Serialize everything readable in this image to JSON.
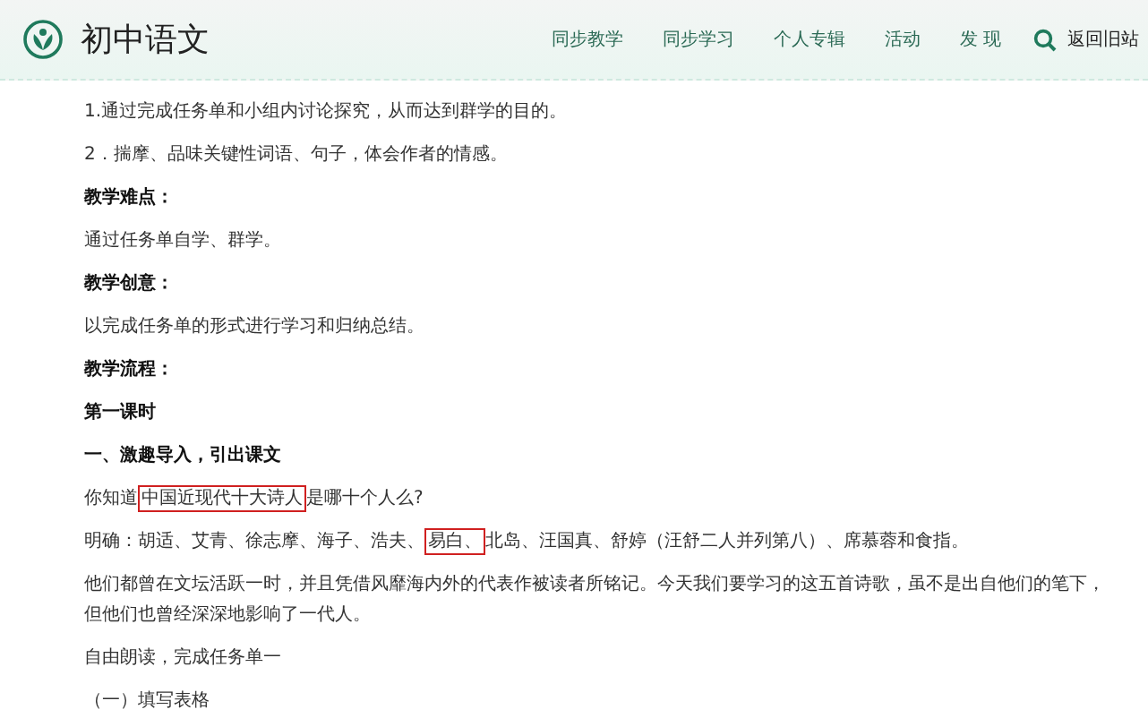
{
  "header": {
    "site_title": "初中语文",
    "nav": [
      {
        "label": "同步教学"
      },
      {
        "label": "同步学习"
      },
      {
        "label": "个人专辑"
      },
      {
        "label": "活动"
      },
      {
        "label": "发 现"
      }
    ],
    "back_link": "返回旧站"
  },
  "article": [
    {
      "kind": "text",
      "segments": [
        {
          "text": "1.通过完成任务单和小组内讨论探究，从而达到群学的目的。",
          "highlighted": false
        }
      ]
    },
    {
      "kind": "text",
      "segments": [
        {
          "text": "2．揣摩、品味关键性词语、句子，体会作者的情感。",
          "highlighted": false
        }
      ]
    },
    {
      "kind": "heading",
      "segments": [
        {
          "text": "教学难点：",
          "highlighted": false
        }
      ]
    },
    {
      "kind": "text",
      "segments": [
        {
          "text": "通过任务单自学、群学。",
          "highlighted": false
        }
      ]
    },
    {
      "kind": "heading",
      "segments": [
        {
          "text": "教学创意：",
          "highlighted": false
        }
      ]
    },
    {
      "kind": "text",
      "segments": [
        {
          "text": "以完成任务单的形式进行学习和归纳总结。",
          "highlighted": false
        }
      ]
    },
    {
      "kind": "heading",
      "segments": [
        {
          "text": "教学流程：",
          "highlighted": false
        }
      ]
    },
    {
      "kind": "heading",
      "segments": [
        {
          "text": "第一课时",
          "highlighted": false
        }
      ]
    },
    {
      "kind": "heading",
      "segments": [
        {
          "text": "一、激趣导入，引出课文",
          "highlighted": false
        }
      ]
    },
    {
      "kind": "text",
      "segments": [
        {
          "text": "你知道",
          "highlighted": false
        },
        {
          "text": "中国近现代十大诗人",
          "highlighted": true
        },
        {
          "text": "是哪十个人么?",
          "highlighted": false
        }
      ]
    },
    {
      "kind": "text",
      "segments": [
        {
          "text": "明确：胡适、艾青、徐志摩、海子、浩夫、",
          "highlighted": false
        },
        {
          "text": "易白、",
          "highlighted": true
        },
        {
          "text": "北岛、汪国真、舒婷（汪舒二人并列第八）、席慕蓉和食指。",
          "highlighted": false
        }
      ]
    },
    {
      "kind": "text",
      "segments": [
        {
          "text": "他们都曾在文坛活跃一时，并且凭借风靡海内外的代表作被读者所铭记。今天我们要学习的这五首诗歌，虽不是出自他们的笔下，但他们也曾经深深地影响了一代人。",
          "highlighted": false
        }
      ]
    },
    {
      "kind": "text",
      "segments": [
        {
          "text": "自由朗读，完成任务单一",
          "highlighted": false
        }
      ]
    },
    {
      "kind": "text",
      "segments": [
        {
          "text": "（一）填写表格",
          "highlighted": false
        }
      ]
    }
  ]
}
